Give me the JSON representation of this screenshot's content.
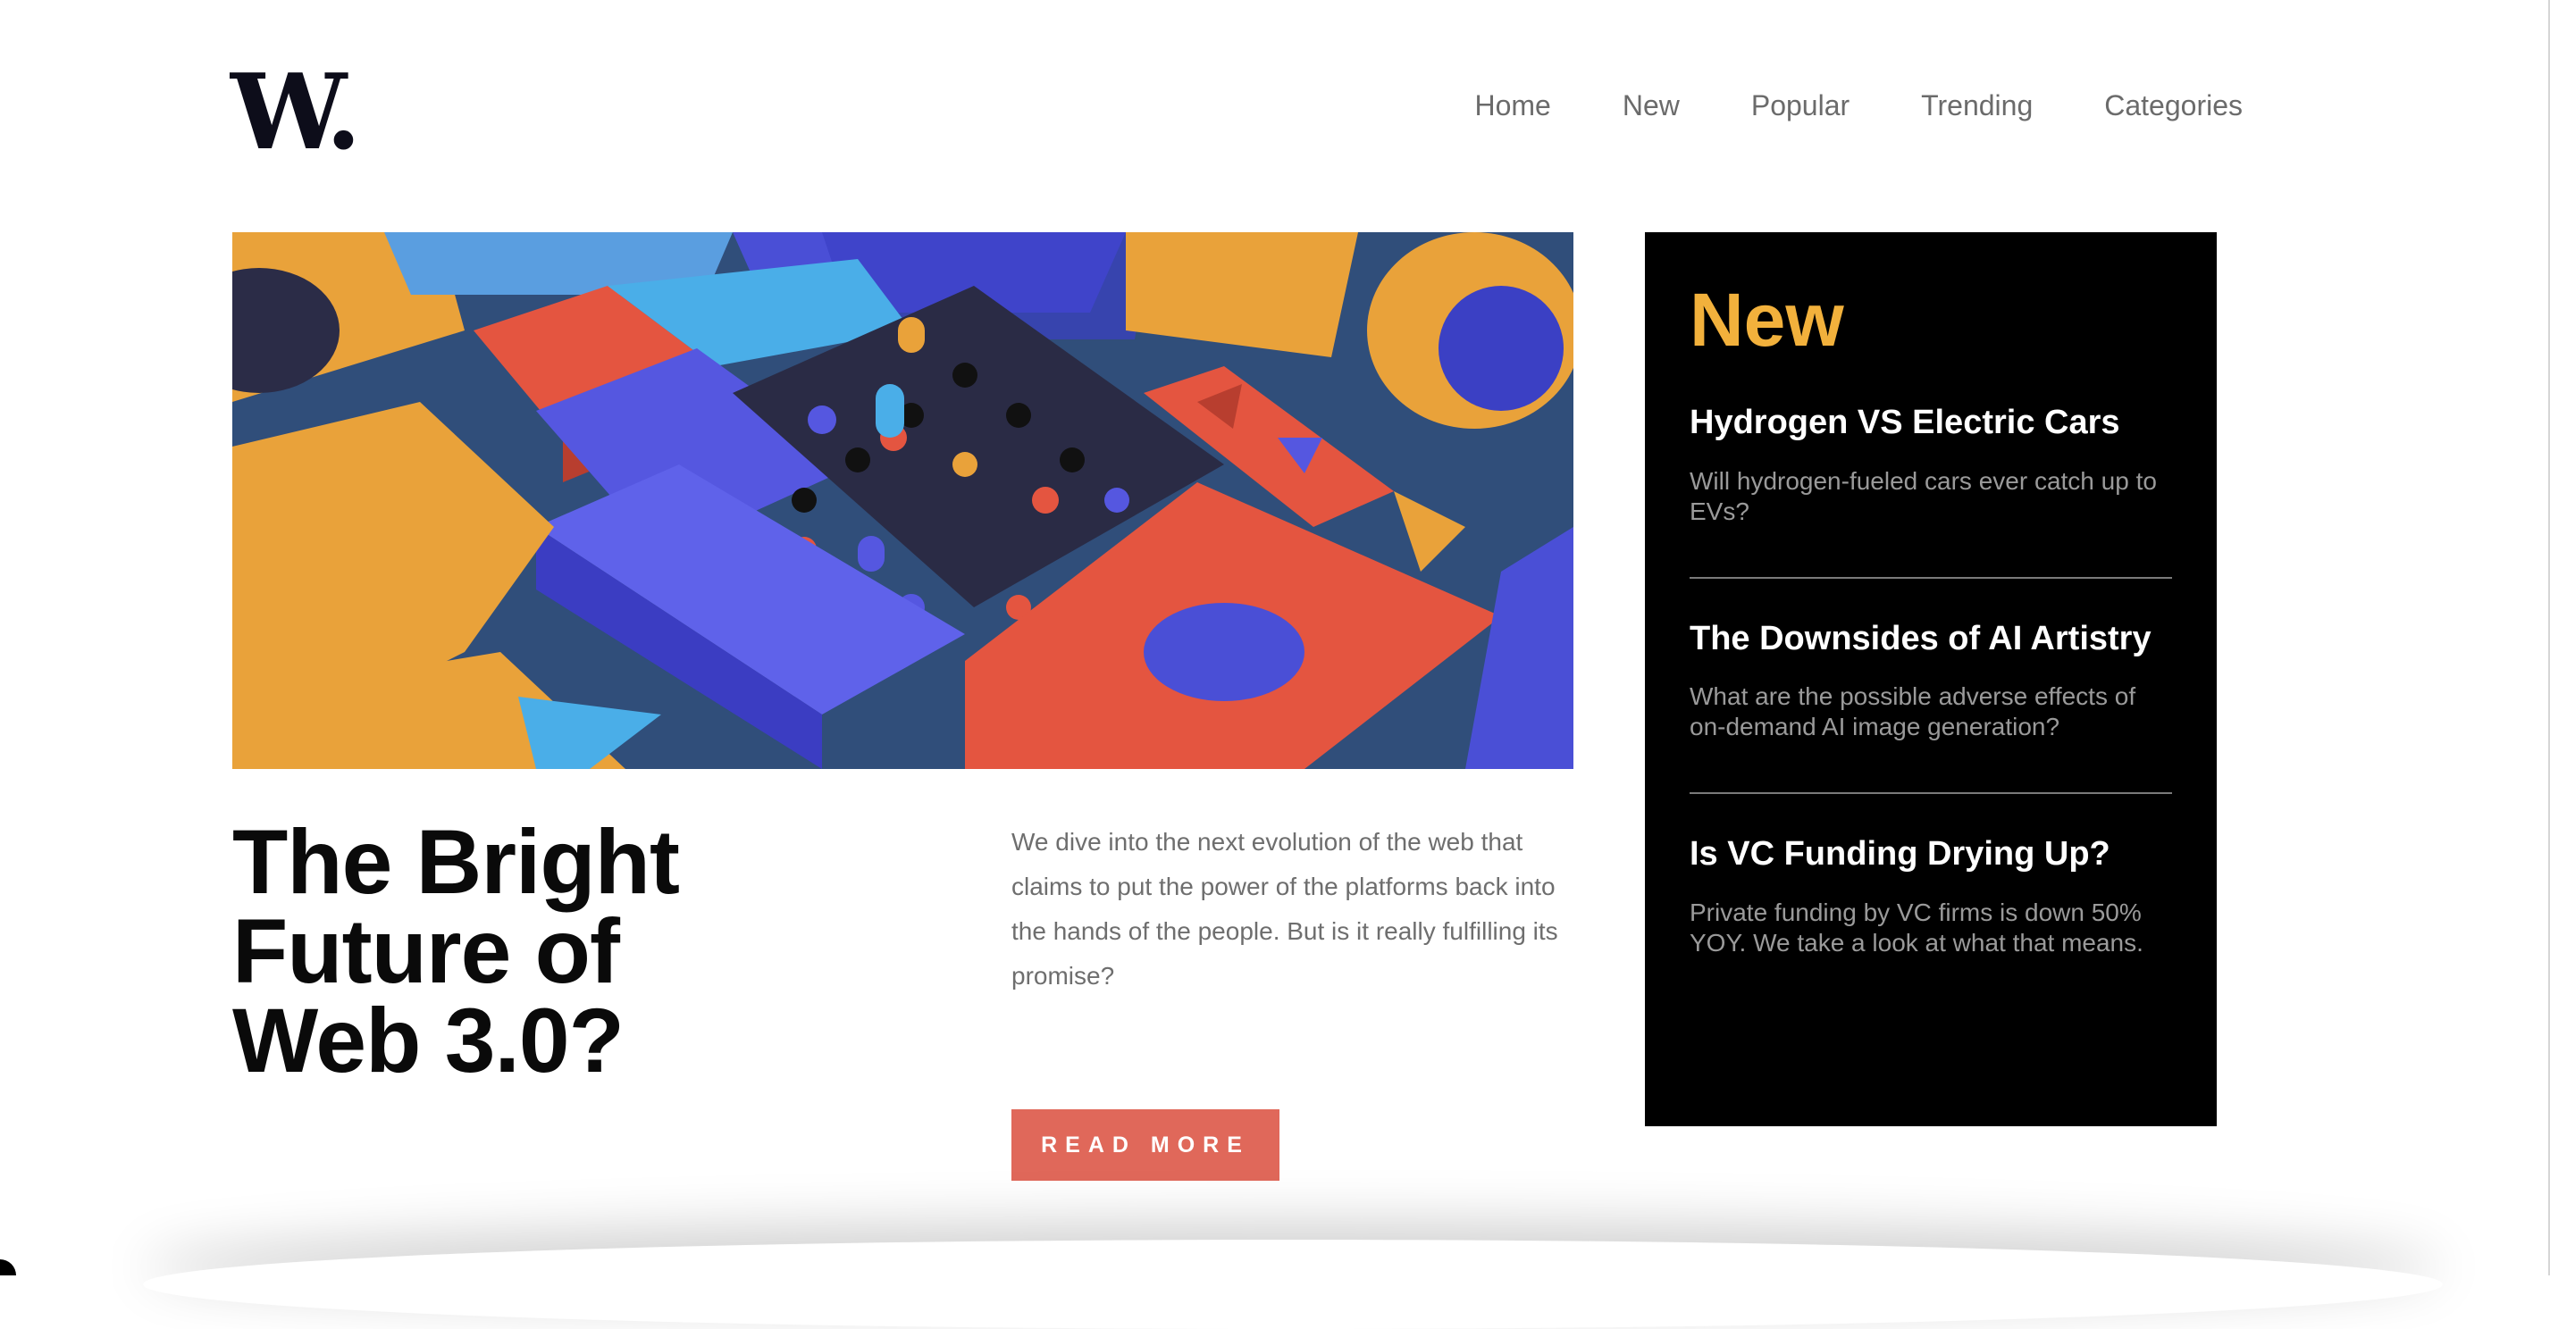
{
  "brand": {
    "logo_text": "W."
  },
  "nav": {
    "items": [
      {
        "label": "Home"
      },
      {
        "label": "New"
      },
      {
        "label": "Popular"
      },
      {
        "label": "Trending"
      },
      {
        "label": "Categories"
      }
    ]
  },
  "hero": {
    "image_icon": "abstract-3d-blocks-illustration"
  },
  "article": {
    "headline_lines": [
      "The Bright",
      "Future of",
      "Web 3.0?"
    ],
    "summary": "We dive into the next evolution of the web that claims to put the power of the platforms back into the hands of the people. But is it really fulfilling its promise?",
    "cta_label": "READ MORE"
  },
  "sidebar": {
    "title": "New",
    "stories": [
      {
        "title": "Hydrogen VS Electric Cars",
        "description": "Will hydrogen-fueled cars ever catch up to EVs?"
      },
      {
        "title": "The Downsides of AI Artistry",
        "description": "What are the possible adverse effects of on-demand AI image generation?"
      },
      {
        "title": "Is VC Funding Drying Up?",
        "description": "Private funding by VC firms is down 50% YOY. We take a look at what that means."
      }
    ]
  },
  "colors": {
    "accent_orange": "#f2b13c",
    "cta_red": "#e0685a",
    "panel_bg": "#000000",
    "text_dark": "#0a0a0a",
    "text_muted": "#6e6e6e"
  }
}
